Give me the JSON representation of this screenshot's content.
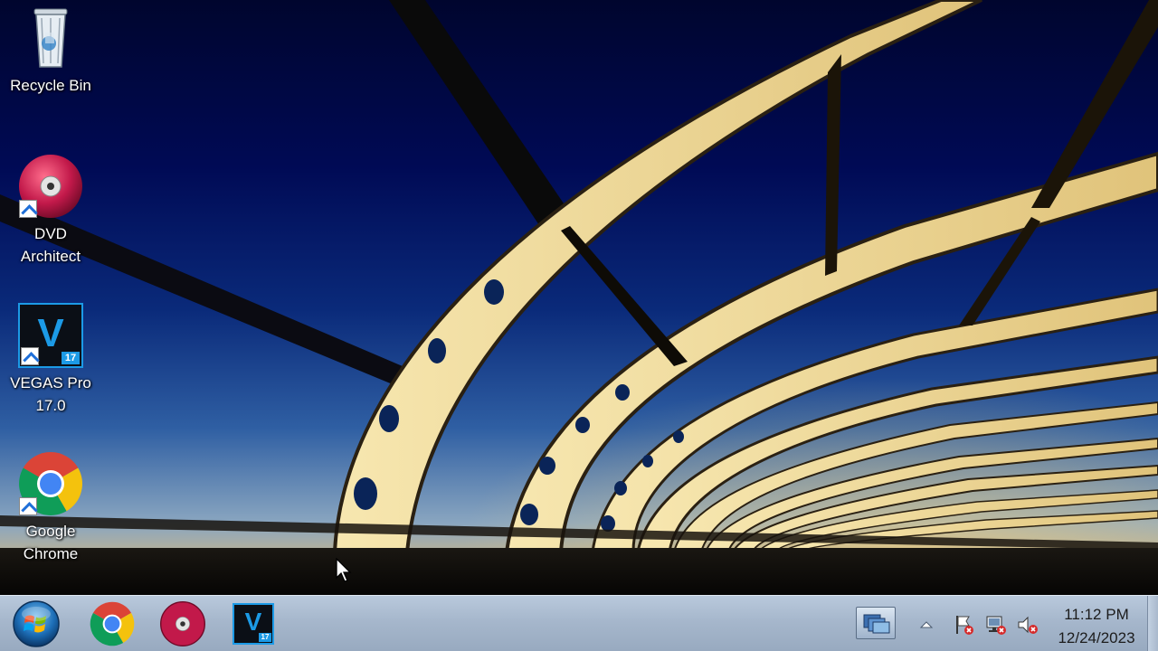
{
  "desktop": {
    "icons": [
      {
        "label": "Recycle Bin",
        "icon": "recycle-bin-icon"
      },
      {
        "label": "DVD\nArchitect",
        "icon": "dvd-architect-icon"
      },
      {
        "label": "VEGAS Pro\n17.0",
        "icon": "vegas-pro-icon"
      },
      {
        "label": "Google\nChrome",
        "icon": "chrome-icon"
      }
    ]
  },
  "taskbar": {
    "pinned": [
      {
        "icon": "chrome-icon"
      },
      {
        "icon": "dvd-architect-icon"
      },
      {
        "icon": "vegas-pro-icon"
      }
    ],
    "vegas_badge": "17",
    "vegas_letter": "V",
    "clock": {
      "time": "11:12 PM",
      "date": "12/24/2023"
    }
  },
  "colors": {
    "taskbar": "#a6b7cc",
    "vegas_blue": "#1c9ae6",
    "chrome_red": "#db4437",
    "chrome_yellow": "#f4c20d",
    "chrome_green": "#0f9d58",
    "chrome_blue": "#4285f4",
    "dvd_red": "#c2194a"
  }
}
